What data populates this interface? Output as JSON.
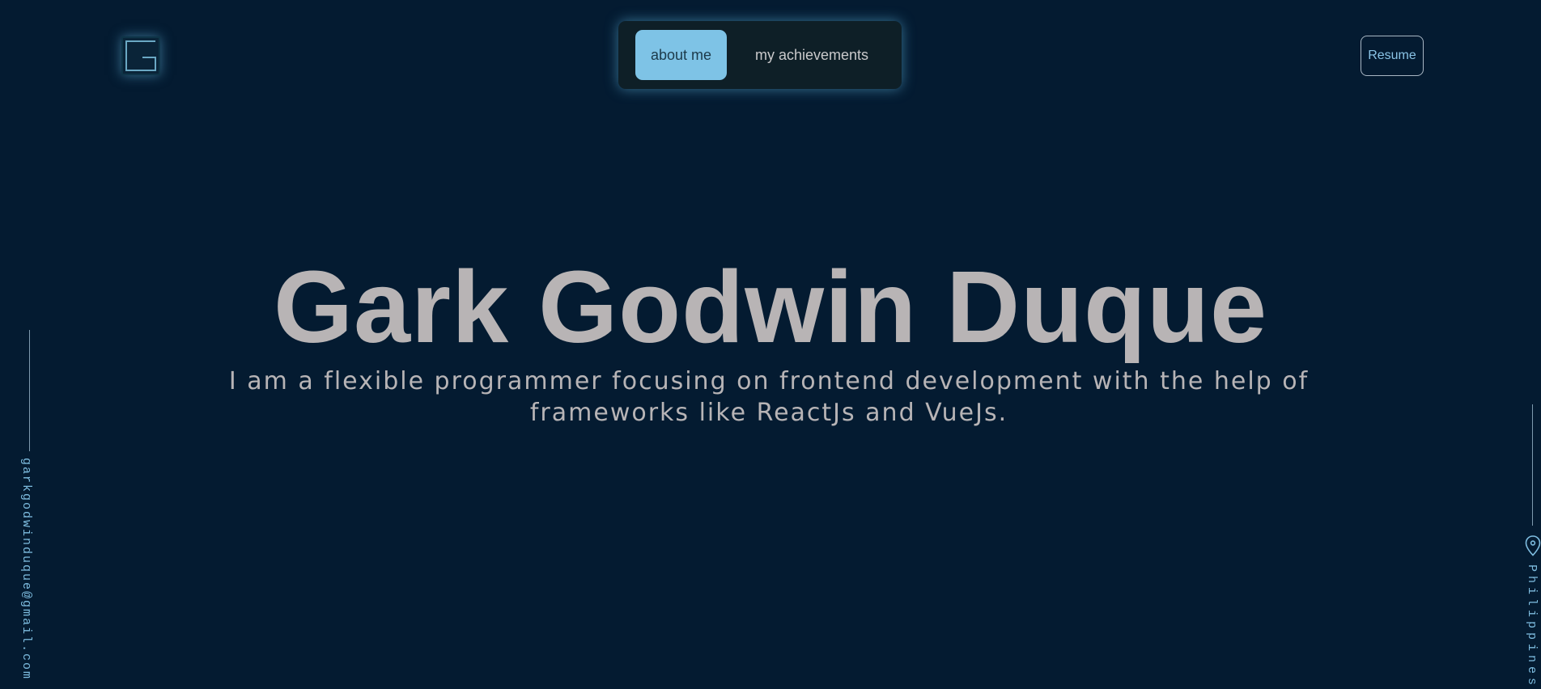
{
  "logo": {
    "icon": "g-logo-icon",
    "glow_color": "#62b4dd"
  },
  "nav": {
    "tabs": [
      {
        "label": "about me",
        "active": true
      },
      {
        "label": "my achievements",
        "active": false
      }
    ],
    "active_color": "#7ec3e6"
  },
  "header": {
    "resume_label": "Resume"
  },
  "hero": {
    "name": "Gark Godwin Duque",
    "tagline": "I am a flexible programmer focusing on frontend development with the help of frameworks like ReactJs and VueJs."
  },
  "sidebar_left": {
    "email": "garkgodwinduque@gmail.com"
  },
  "sidebar_right": {
    "location": "Philippines",
    "icon": "location-pin-icon"
  },
  "colors": {
    "background": "#041b31",
    "accent": "#7ebde0",
    "text": "#b7b4b6"
  }
}
